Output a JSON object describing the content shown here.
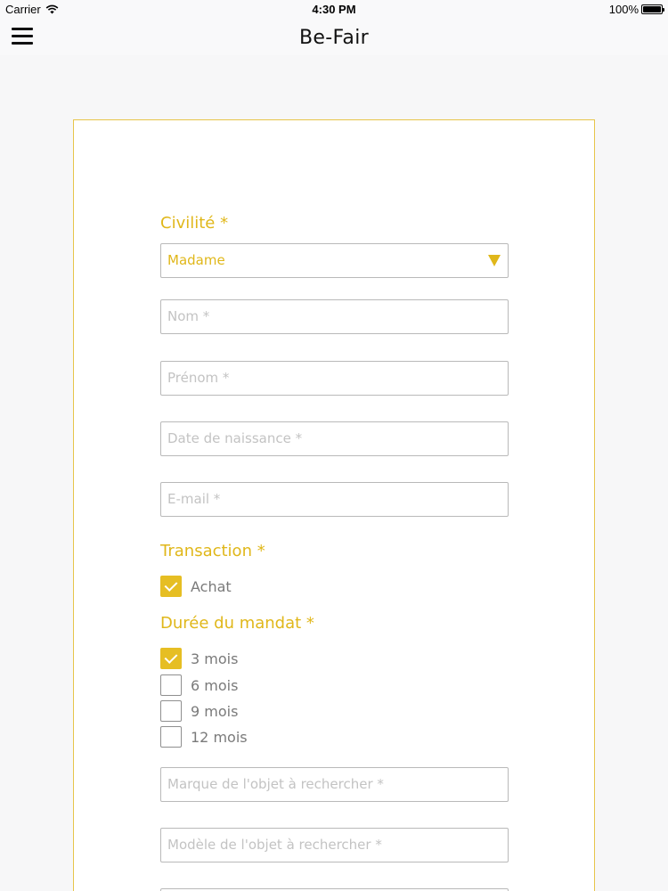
{
  "status_bar": {
    "carrier": "Carrier",
    "time": "4:30 PM",
    "battery": "100%"
  },
  "nav": {
    "title": "Be-Fair"
  },
  "form": {
    "civilite_label": "Civilité *",
    "civilite_value": "Madame",
    "nom_placeholder": "Nom *",
    "prenom_placeholder": "Prénom *",
    "date_placeholder": "Date de naissance *",
    "email_placeholder": "E-mail *",
    "transaction_label": "Transaction *",
    "transaction_option": {
      "label": "Achat",
      "checked": true
    },
    "duree_label": "Durée du mandat *",
    "duree_options": [
      {
        "label": "3 mois",
        "checked": true
      },
      {
        "label": "6 mois",
        "checked": false
      },
      {
        "label": "9 mois",
        "checked": false
      },
      {
        "label": "12 mois",
        "checked": false
      }
    ],
    "marque_placeholder": "Marque de l'objet à rechercher *",
    "modele_placeholder": "Modèle de l'objet à rechercher *"
  },
  "colors": {
    "accent": "#e0b71a",
    "card_border": "#e7c54a",
    "background": "#f7f7f8"
  }
}
